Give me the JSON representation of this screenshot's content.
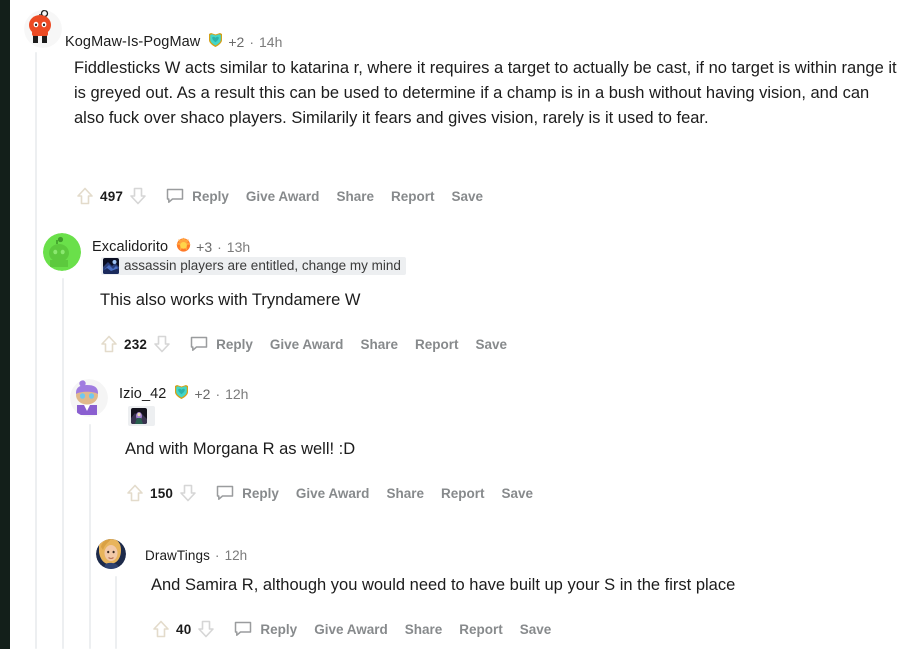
{
  "page": {
    "title": "Reddit comment thread",
    "colors": {
      "left_rail": "#131f1a",
      "background": "#ffffff",
      "thread_line": "#edeff1",
      "action_text": "#878a8c",
      "body_text": "#1c1c1c",
      "meta_text": "#7c7c7c",
      "upvote_arrow": "#e8e1d4",
      "downvote_arrow": "#d3d3d3"
    }
  },
  "actions": {
    "reply": "Reply",
    "give_award": "Give Award",
    "share": "Share",
    "report": "Report",
    "save": "Save",
    "separator": "·"
  },
  "comments": [
    {
      "id": "comment-1",
      "depth": 0,
      "username": "KogMaw-Is-PogMaw",
      "avatar": "snoo-orange-avatar",
      "award_icon": "gold-shield-award-icon",
      "award_count": "+2",
      "timestamp": "14h",
      "flair": null,
      "body": "Fiddlesticks W acts similar to katarina r, where it requires a target to actually be cast, if no target is within range it is greyed out. As a result this can be used to determine if a champ is in a bush without having vision, and can also fuck over shaco players. Similarily it fears and gives vision, rarely is it used to fear.",
      "score": "497"
    },
    {
      "id": "comment-2",
      "depth": 1,
      "username": "Excalidorito",
      "avatar": "snoo-green-avatar",
      "award_icon": "orange-fire-award-icon",
      "award_count": "+3",
      "timestamp": "13h",
      "flair": {
        "image": "champion-splash-flair-icon",
        "text": "assassin players are entitled, change my mind"
      },
      "body": "This also works with Tryndamere W",
      "score": "232"
    },
    {
      "id": "comment-3",
      "depth": 2,
      "username": "Izio_42",
      "avatar": "snoo-purple-avatar",
      "award_icon": "gold-shield-award-icon",
      "award_count": "+2",
      "timestamp": "12h",
      "flair": {
        "image": "champion-splash-flair-icon",
        "text": ""
      },
      "body": "And with Morgana R as well! :D",
      "score": "150"
    },
    {
      "id": "comment-4",
      "depth": 3,
      "username": "DrawTings",
      "avatar": "photo-portrait-avatar",
      "award_icon": null,
      "award_count": null,
      "timestamp": "12h",
      "flair": null,
      "body": "And Samira R, although you would need to have built up your S in the first place",
      "score": "40"
    }
  ]
}
